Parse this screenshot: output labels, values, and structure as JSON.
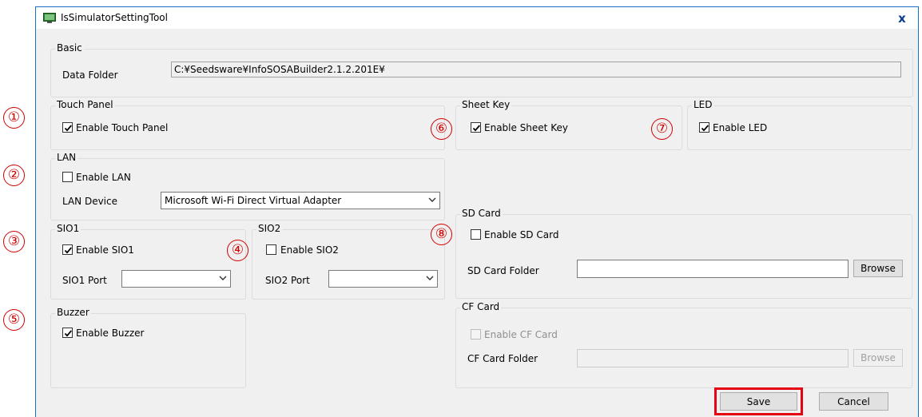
{
  "window": {
    "title": "IsSimulatorSettingTool",
    "close_label": "x",
    "accent_color": "#1c6fc6"
  },
  "markers": [
    "①",
    "②",
    "③",
    "④",
    "⑤",
    "⑥",
    "⑦",
    "⑧"
  ],
  "basic": {
    "legend": "Basic",
    "data_folder_label": "Data Folder",
    "data_folder_value": "C:¥Seedsware¥InfoSOSABuilder2.1.2.201E¥"
  },
  "touch_panel": {
    "legend": "Touch Panel",
    "enable_label": "Enable Touch Panel",
    "checked": true
  },
  "sheet_key": {
    "legend": "Sheet Key",
    "enable_label": "Enable Sheet Key",
    "checked": true
  },
  "led": {
    "legend": "LED",
    "enable_label": "Enable LED",
    "checked": true
  },
  "lan": {
    "legend": "LAN",
    "enable_label": "Enable LAN",
    "checked": false,
    "device_label": "LAN Device",
    "device_value": "Microsoft Wi-Fi Direct Virtual Adapter"
  },
  "sio1": {
    "legend": "SIO1",
    "enable_label": "Enable SIO1",
    "checked": true,
    "port_label": "SIO1 Port",
    "port_value": ""
  },
  "sio2": {
    "legend": "SIO2",
    "enable_label": "Enable SIO2",
    "checked": false,
    "port_label": "SIO2 Port",
    "port_value": ""
  },
  "buzzer": {
    "legend": "Buzzer",
    "enable_label": "Enable Buzzer",
    "checked": true
  },
  "sd_card": {
    "legend": "SD Card",
    "enable_label": "Enable SD Card",
    "checked": false,
    "folder_label": "SD Card Folder",
    "folder_value": "",
    "browse_label": "Browse"
  },
  "cf_card": {
    "legend": "CF Card",
    "enable_label": "Enable CF Card",
    "checked": false,
    "folder_label": "CF Card Folder",
    "folder_value": "",
    "browse_label": "Browse",
    "enabled": false
  },
  "footer": {
    "save_label": "Save",
    "cancel_label": "Cancel",
    "highlight_color": "#e60012"
  }
}
